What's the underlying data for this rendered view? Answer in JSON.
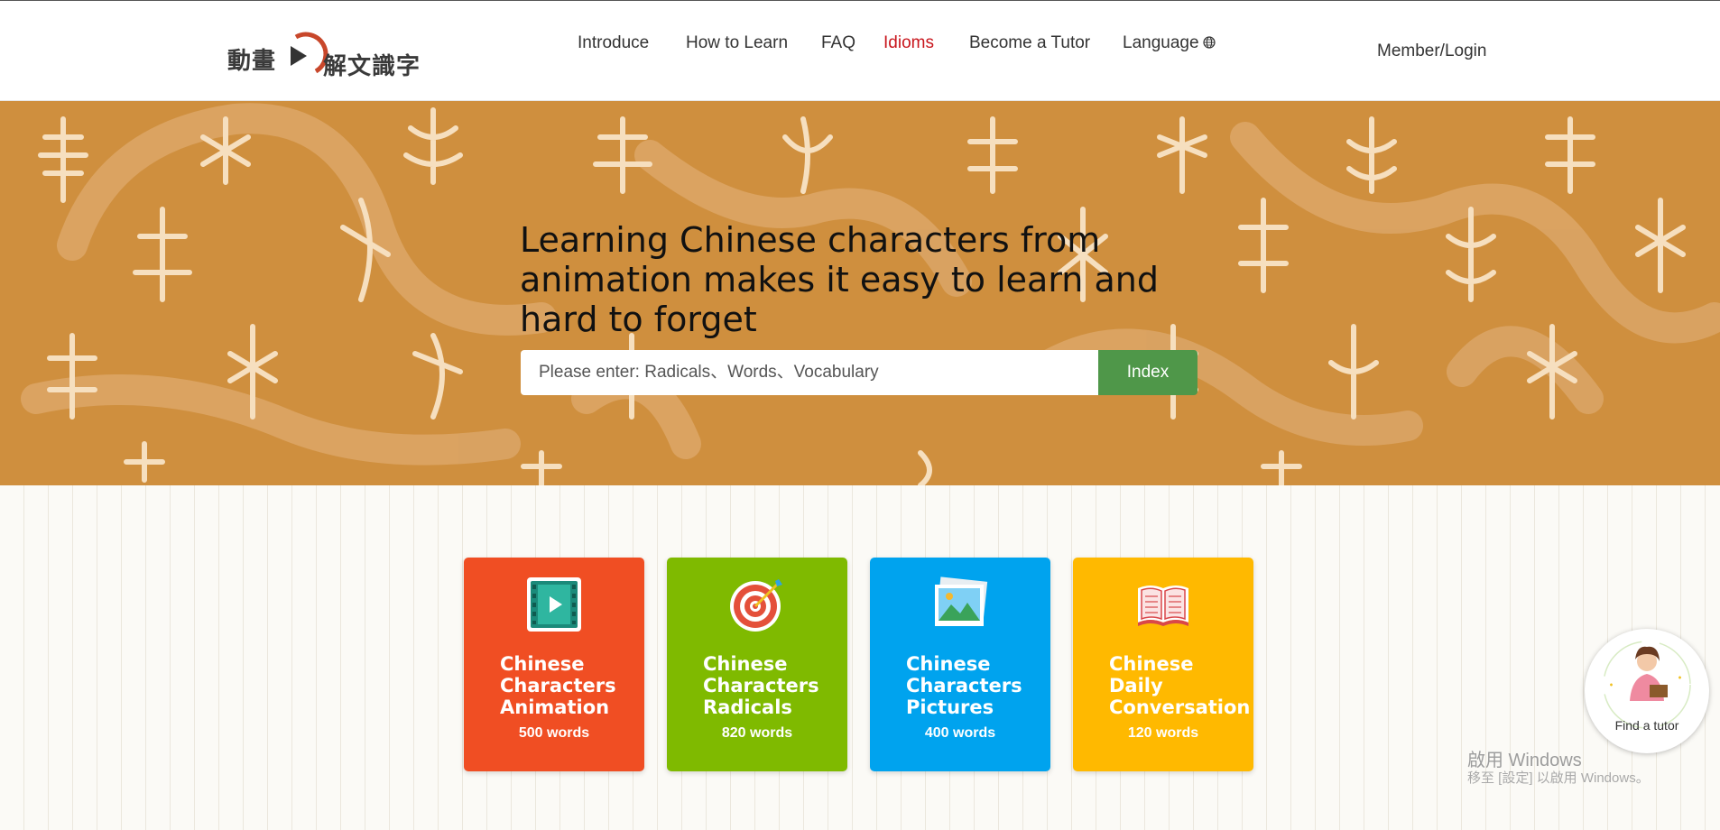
{
  "header": {
    "logo_text_left": "動畫",
    "logo_text_right": "解文識字",
    "nav": [
      {
        "label": "Introduce",
        "active": false
      },
      {
        "label": "How to Learn",
        "active": false
      },
      {
        "label": "FAQ",
        "active": false
      },
      {
        "label": "Idioms",
        "active": true
      },
      {
        "label": "Become a Tutor",
        "active": false
      },
      {
        "label": "Language",
        "active": false
      }
    ],
    "member_login": "Member/Login",
    "active_color": "#c8161d"
  },
  "hero": {
    "title": "Learning Chinese characters from animation makes it easy to learn and hard to forget",
    "search_placeholder": "Please enter: Radicals、Words、Vocabulary",
    "search_button": "Index",
    "background_color": "#cf8f3e",
    "button_color": "#4f9749"
  },
  "cards": [
    {
      "title": "Chinese Characters Animation",
      "count": "500 words",
      "color": "#f04e23",
      "icon": "film-play-icon"
    },
    {
      "title": "Chinese Characters Radicals",
      "count": "820 words",
      "color": "#7fba00",
      "icon": "target-dart-icon"
    },
    {
      "title": "Chinese Characters Pictures",
      "count": "400 words",
      "color": "#00a3ee",
      "icon": "photo-icon"
    },
    {
      "title": "Chinese Daily Conversation",
      "count": "120 words",
      "color": "#ffb900",
      "icon": "open-book-icon"
    }
  ],
  "tutor": {
    "label": "Find a tutor"
  },
  "windows_watermark": {
    "line1": "啟用 Windows",
    "line2": "移至 [設定] 以啟用 Windows。"
  }
}
